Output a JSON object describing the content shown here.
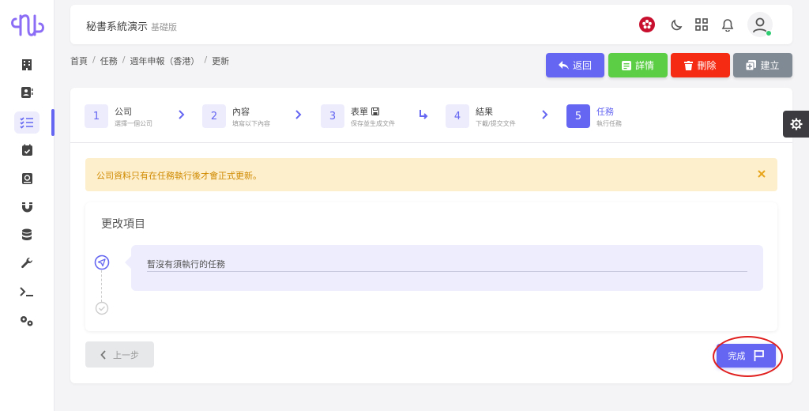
{
  "app": {
    "title": "秘書系統演示",
    "subtitle": "基礎版"
  },
  "sidebar": {
    "items": [
      {
        "name": "building-icon"
      },
      {
        "name": "contacts-icon"
      },
      {
        "name": "tasks-icon",
        "active": true
      },
      {
        "name": "calendar-check-icon"
      },
      {
        "name": "address-book-icon"
      },
      {
        "name": "magnet-icon"
      },
      {
        "name": "database-icon"
      },
      {
        "name": "wrench-icon"
      },
      {
        "name": "terminal-icon"
      },
      {
        "name": "cogs-icon"
      }
    ]
  },
  "header": {
    "icons": [
      "hong-kong-flag-icon",
      "moon-icon",
      "grid-icon",
      "bell-icon",
      "user-avatar-icon"
    ]
  },
  "breadcrumb": [
    "首頁",
    "任務",
    "週年申報（香港）",
    "更新"
  ],
  "actions": {
    "back": "返回",
    "detail": "詳情",
    "delete": "刪除",
    "create": "建立"
  },
  "steps": [
    {
      "num": "1",
      "title": "公司",
      "desc": "選擇一個公司"
    },
    {
      "num": "2",
      "title": "內容",
      "desc": "填寫以下內容"
    },
    {
      "num": "3",
      "title": "表單",
      "desc": "保存並生成文件"
    },
    {
      "num": "4",
      "title": "結果",
      "desc": "下載/提交文件"
    },
    {
      "num": "5",
      "title": "任務",
      "desc": "執行任務",
      "active": true
    }
  ],
  "alert": {
    "text": "公司資料只有在任務執行後才會正式更新。"
  },
  "changes": {
    "title": "更改項目",
    "empty_text": "暫沒有須執行的任務"
  },
  "footer": {
    "prev": "上一步",
    "finish": "完成"
  },
  "colors": {
    "primary": "#6566f1",
    "success": "#5bce46",
    "danger": "#f52b14",
    "secondary": "#808a94",
    "alert_bg": "#fdefcc",
    "alert_text": "#d08a00"
  }
}
